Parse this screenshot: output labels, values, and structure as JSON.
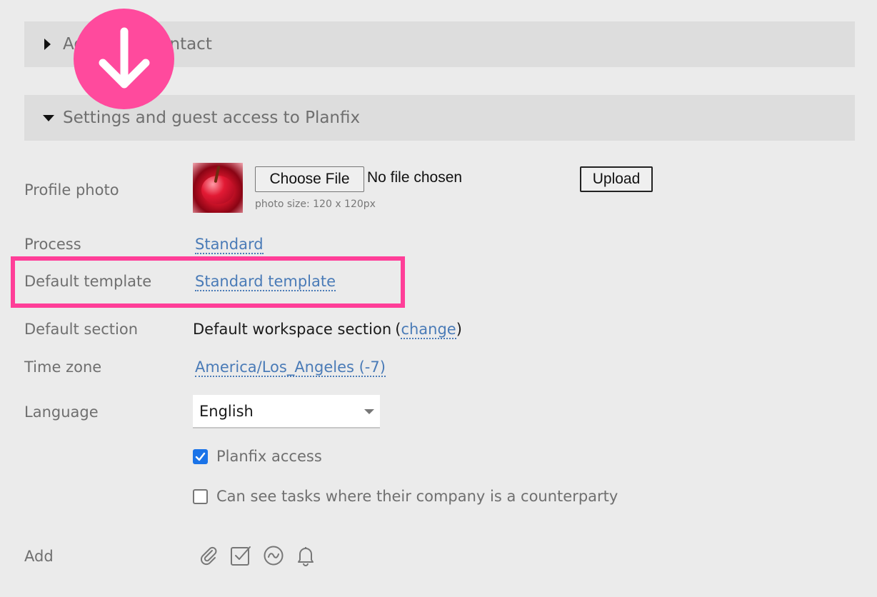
{
  "sections": {
    "collapsed_title": "Additional contact",
    "expanded_title": "Settings and guest access to Planfix"
  },
  "profile_photo": {
    "label": "Profile photo",
    "choose_file_label": "Choose File",
    "file_status": "No file chosen",
    "upload_label": "Upload",
    "hint": "photo size: 120 x 120px"
  },
  "process": {
    "label": "Process",
    "value": "Standard"
  },
  "default_template": {
    "label": "Default template",
    "value": "Standard template"
  },
  "default_section": {
    "label": "Default section",
    "value": "Default workspace section",
    "open_paren": "(",
    "change_link": "change",
    "close_paren": ")"
  },
  "time_zone": {
    "label": "Time zone",
    "value": "America/Los_Angeles (-7)"
  },
  "language": {
    "label": "Language",
    "selected": "English"
  },
  "checkboxes": [
    {
      "label": "Planfix access",
      "checked": true
    },
    {
      "label": "Can see tasks where their company is a counterparty",
      "checked": false
    }
  ],
  "add": {
    "label": "Add",
    "icons": [
      "paperclip-icon",
      "checkbox-task-icon",
      "wave-icon",
      "bell-icon"
    ]
  },
  "colors": {
    "background": "#ebebeb",
    "section_header_bg": "#dddddd",
    "link": "#4a7bb7",
    "highlight": "#ff3e98",
    "overlay": "#ff4a9d",
    "checkbox_accent": "#1a73e8"
  }
}
